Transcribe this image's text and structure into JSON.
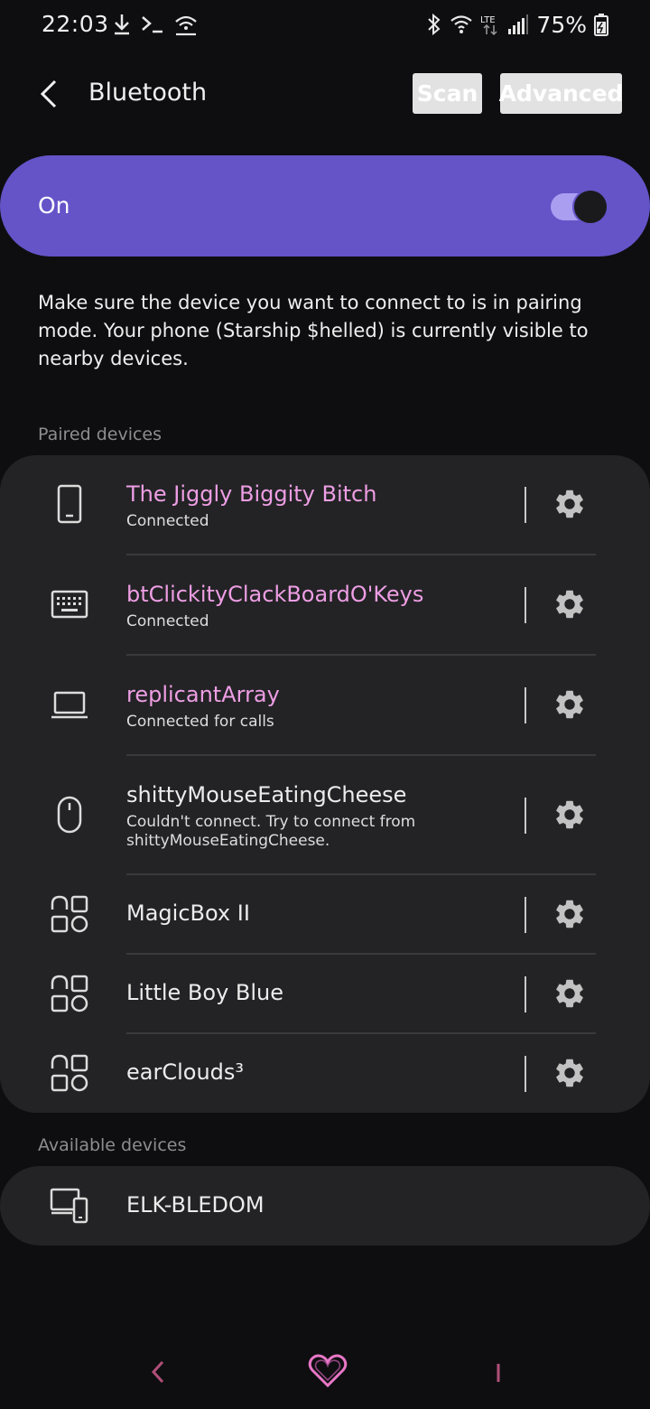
{
  "status": {
    "time": "22:03",
    "battery": "75%",
    "icons": [
      "download-icon",
      "terminal-icon",
      "wifi-hotspot-icon",
      "bluetooth-icon",
      "wifi-icon",
      "lte-icon",
      "signal-icon",
      "battery-icon"
    ]
  },
  "header": {
    "title": "Bluetooth",
    "scan_label": "Scan",
    "advanced_label": "Advanced"
  },
  "master": {
    "label": "On",
    "enabled": true
  },
  "hint": "Make sure the device you want to connect to is in pairing mode. Your phone (Starship $helled) is currently visible to nearby devices.",
  "paired": {
    "label": "Paired devices",
    "devices": [
      {
        "name": "The Jiggly Biggity Bitch",
        "status": "Connected",
        "icon": "phone-icon"
      },
      {
        "name": "btClickityClackBoardO'Keys",
        "status": "Connected",
        "icon": "keyboard-icon"
      },
      {
        "name": "replicantArray",
        "status": "Connected for calls",
        "icon": "laptop-icon"
      },
      {
        "name": "shittyMouseEatingCheese",
        "status": "Couldn't connect. Try to connect from shittyMouseEatingCheese.",
        "icon": "mouse-icon"
      },
      {
        "name": "MagicBox II",
        "status": "",
        "icon": "generic-device-icon"
      },
      {
        "name": "Little Boy Blue",
        "status": "",
        "icon": "generic-device-icon"
      },
      {
        "name": "earClouds³",
        "status": "",
        "icon": "generic-device-icon"
      }
    ]
  },
  "available": {
    "label": "Available devices",
    "devices": [
      {
        "name": "ELK-BLEDOM",
        "icon": "multi-device-icon"
      }
    ]
  },
  "colors": {
    "accent": "#6454c8",
    "connected_name": "#ee9ee4",
    "card": "#232325",
    "background": "#0e0e10"
  },
  "navbar": {
    "icons": [
      "nav-back-icon",
      "nav-home-heart-icon",
      "nav-recents-icon"
    ]
  }
}
